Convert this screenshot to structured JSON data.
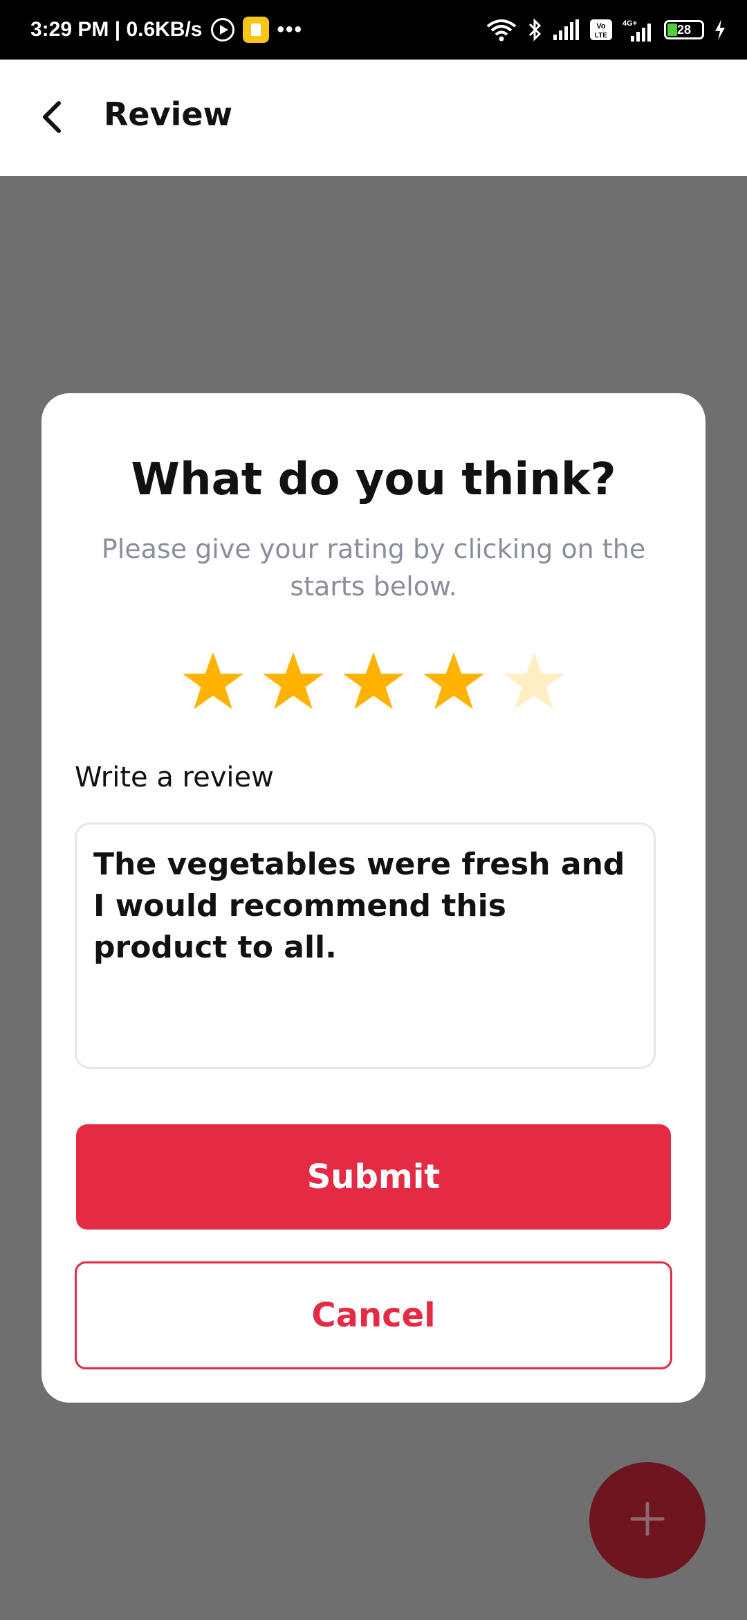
{
  "status_bar": {
    "time_speed": "3:29 PM | 0.6KB/s",
    "dots": "•••",
    "battery_level": "28",
    "icons": [
      "play-icon",
      "app-notification-icon",
      "wifi-icon",
      "bluetooth-icon",
      "signal-icon",
      "volte-icon",
      "4g-signal-icon",
      "battery-icon",
      "charging-icon"
    ]
  },
  "app_bar": {
    "title": "Review",
    "back_icon": "back-arrow-icon"
  },
  "dialog": {
    "title": "What do you think?",
    "subtitle": "Please give your rating by clicking on the starts below.",
    "rating": 4,
    "rating_max": 5,
    "star_color": "#ffb300",
    "star_inactive_color": "#ffeec2",
    "review_label": "Write a review",
    "review_text": "The vegetables were fresh and I would recommend this product to all.",
    "submit_label": "Submit",
    "cancel_label": "Cancel",
    "accent_color": "#e52a44"
  },
  "fab": {
    "icon": "plus-icon"
  }
}
